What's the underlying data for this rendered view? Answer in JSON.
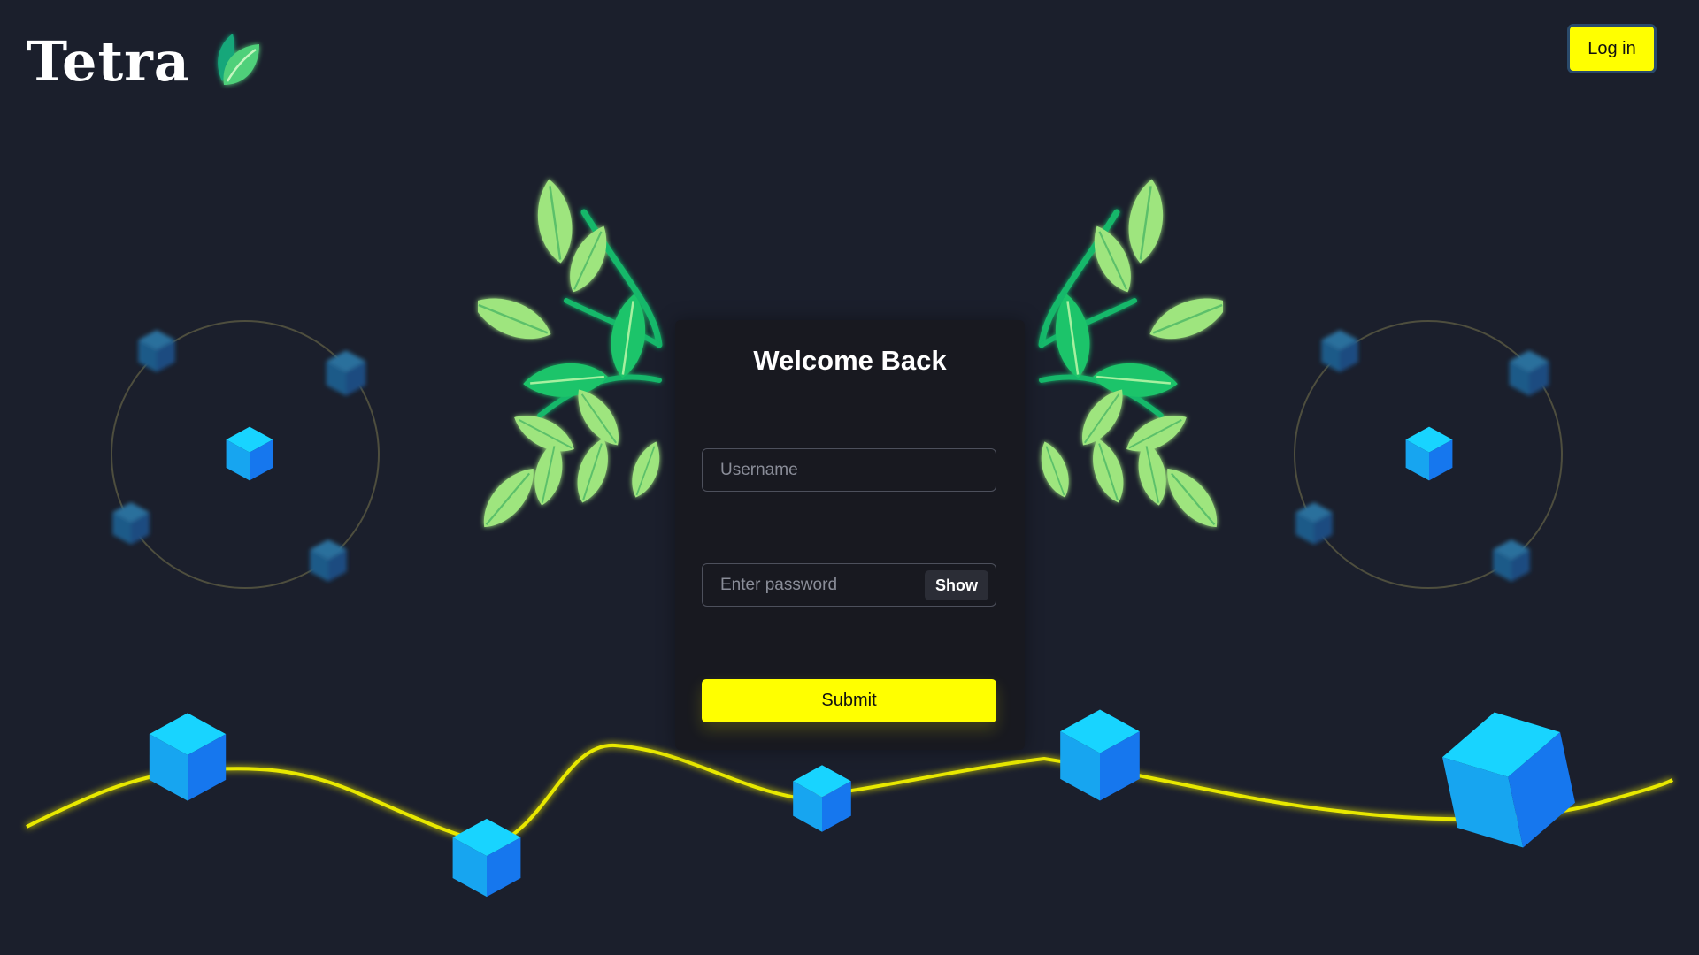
{
  "brand": {
    "name": "Tetra",
    "logo_icon": "leaf-icon"
  },
  "header": {
    "login_label": "Log in"
  },
  "form": {
    "title": "Welcome Back",
    "username_placeholder": "Username",
    "password_placeholder": "Enter password",
    "show_label": "Show",
    "submit_label": "Submit"
  },
  "colors": {
    "background": "#1b1f2c",
    "accent": "#ffff00",
    "card": "#181920",
    "cube": "#1ea8f5",
    "leaf": "#5ed67c"
  },
  "decor": {
    "cube_icon": "cube-icon",
    "branch_icon": "leaf-branch-icon",
    "orbit_icon": "orbit-icon"
  }
}
